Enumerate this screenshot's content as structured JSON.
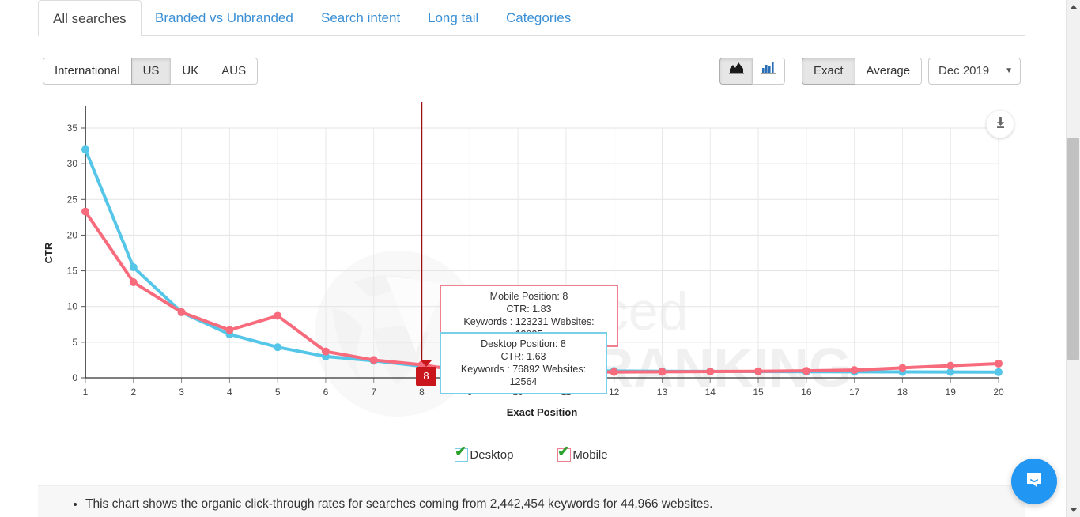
{
  "tabs": [
    {
      "label": "All searches",
      "active": true
    },
    {
      "label": "Branded vs Unbranded",
      "active": false
    },
    {
      "label": "Search intent",
      "active": false
    },
    {
      "label": "Long tail",
      "active": false
    },
    {
      "label": "Categories",
      "active": false
    }
  ],
  "toolbar": {
    "regions": [
      {
        "label": "International",
        "active": false
      },
      {
        "label": "US",
        "active": true
      },
      {
        "label": "UK",
        "active": false
      },
      {
        "label": "AUS",
        "active": false
      }
    ],
    "chart_types": [
      {
        "icon": "area-chart-icon",
        "active": true
      },
      {
        "icon": "bar-chart-icon",
        "active": false
      }
    ],
    "metrics": [
      {
        "label": "Exact",
        "active": true
      },
      {
        "label": "Average",
        "active": false
      }
    ],
    "date": {
      "value": "Dec 2019",
      "caret": "▼"
    }
  },
  "download_button": {
    "icon": "download-icon"
  },
  "watermark": {
    "line1": "Advanced",
    "line2": "WEB RANKING"
  },
  "tooltips": {
    "mobile": {
      "title": "Mobile Position: 8",
      "ctr": "CTR: 1.83",
      "counts": "Keywords : 123231 Websites: 13935"
    },
    "desktop": {
      "title": "Desktop Position: 8",
      "ctr": "CTR: 1.63",
      "counts": "Keywords : 76892 Websites: 12564"
    }
  },
  "marker": {
    "position": "8"
  },
  "legend": [
    {
      "label": "Desktop",
      "color": "#79cfe8",
      "checked": true
    },
    {
      "label": "Mobile",
      "color": "#f0808f",
      "checked": true
    }
  ],
  "notes": [
    "This chart shows the organic click-through rates for searches coming from 2,442,454 keywords for 44,966 websites."
  ],
  "chat": {
    "icon": "chat-bubble-icon"
  },
  "chart_data": {
    "type": "line",
    "title": "",
    "xlabel": "Exact Position",
    "ylabel": "CTR",
    "x": [
      1,
      2,
      3,
      4,
      5,
      6,
      7,
      8,
      9,
      10,
      11,
      12,
      13,
      14,
      15,
      16,
      17,
      18,
      19,
      20
    ],
    "xticks": [
      "1",
      "2",
      "3",
      "4",
      "5",
      "6",
      "7",
      "8",
      "9",
      "10",
      "11",
      "12",
      "13",
      "14",
      "15",
      "16",
      "17",
      "18",
      "19",
      "20"
    ],
    "yticks": [
      0,
      5,
      10,
      15,
      20,
      25,
      30,
      35
    ],
    "ylim": [
      0,
      35
    ],
    "xlim": [
      1,
      20
    ],
    "grid": true,
    "legend_position": "bottom",
    "highlight_x": 8,
    "series": [
      {
        "name": "Desktop",
        "color": "#56c6e8",
        "values": [
          32.0,
          15.5,
          9.2,
          6.1,
          4.3,
          3.0,
          2.4,
          1.63,
          1.2,
          1.1,
          1.0,
          0.95,
          0.92,
          0.9,
          0.88,
          0.86,
          0.85,
          0.83,
          0.82,
          0.8
        ]
      },
      {
        "name": "Mobile",
        "color": "#f76b7c",
        "values": [
          23.3,
          13.4,
          9.2,
          6.7,
          8.7,
          3.7,
          2.5,
          1.83,
          0.8,
          0.8,
          0.8,
          0.82,
          0.85,
          0.88,
          0.92,
          0.98,
          1.1,
          1.4,
          1.7,
          2.0
        ]
      }
    ]
  }
}
